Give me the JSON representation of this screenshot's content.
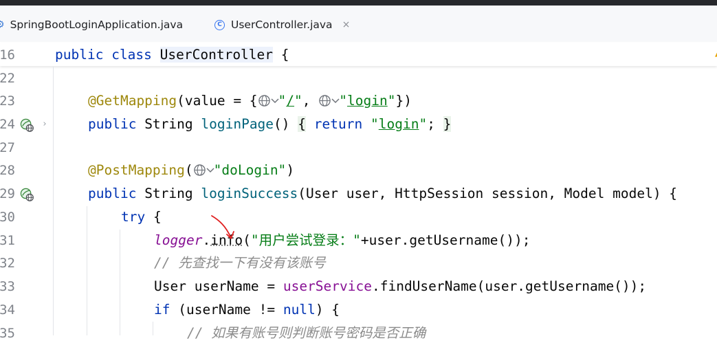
{
  "editor": {
    "tabs": [
      {
        "label": "SpringBootLoginApplication.java",
        "active": false
      },
      {
        "label": "UserController.java",
        "active": true
      }
    ],
    "close_glyph": "×",
    "warning_glyph": "▲"
  },
  "code": {
    "lines": [
      {
        "num": "16",
        "tokens": [
          "public",
          " ",
          "class",
          " ",
          "UserController",
          " {"
        ]
      },
      {
        "num": "22",
        "tokens": []
      },
      {
        "num": "23",
        "tokens": [
          "@GetMapping",
          "(value = {",
          "\"",
          "/",
          "\"",
          ", ",
          "\"",
          "login",
          "\"",
          "})"
        ]
      },
      {
        "num": "24",
        "tokens": [
          "public",
          " String ",
          "loginPage",
          "() ",
          "{",
          " ",
          "return",
          " ",
          "\"",
          "login",
          "\"",
          "; ",
          "}"
        ]
      },
      {
        "num": "27",
        "tokens": []
      },
      {
        "num": "28",
        "tokens": [
          "@PostMapping",
          "(",
          "\"doLogin\"",
          ")"
        ]
      },
      {
        "num": "29",
        "tokens": [
          "public",
          " String ",
          "loginSuccess",
          "(User user, HttpSession session, Model model) {"
        ]
      },
      {
        "num": "30",
        "tokens": [
          "try",
          " {"
        ]
      },
      {
        "num": "31",
        "tokens": [
          "logger",
          ".",
          "info",
          "(",
          "\"用户尝试登录：\"",
          "+user.getUsername());"
        ]
      },
      {
        "num": "32",
        "tokens": [
          "// 先查找一下有没有该账号"
        ]
      },
      {
        "num": "33",
        "tokens": [
          "User userName = ",
          "userService",
          ".findUserName(user.getUsername());"
        ]
      },
      {
        "num": "34",
        "tokens": [
          "if",
          " (userName != ",
          "null",
          ") {"
        ]
      },
      {
        "num": "35",
        "tokens": [
          "// 如果有账号则判断账号密码是否正确"
        ]
      }
    ]
  },
  "colors": {
    "keyword": "#0033b3",
    "annotation": "#9e880d",
    "string": "#067d17",
    "method": "#00627a",
    "field": "#871094",
    "comment": "#8c8c8c",
    "accent": "#3574f0"
  }
}
